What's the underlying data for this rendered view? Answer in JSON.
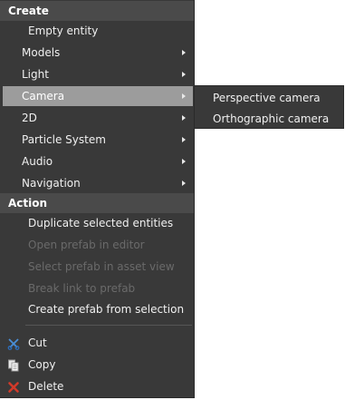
{
  "context_menu": {
    "create_header": "Create",
    "create_items": [
      {
        "label": "Empty entity"
      },
      {
        "label": "Models"
      },
      {
        "label": "Light"
      },
      {
        "label": "Camera"
      },
      {
        "label": "2D"
      },
      {
        "label": "Particle System"
      },
      {
        "label": "Audio"
      },
      {
        "label": "Navigation"
      }
    ],
    "action_header": "Action",
    "action_items": [
      {
        "label": "Duplicate selected entities",
        "enabled": true
      },
      {
        "label": "Open prefab in editor",
        "enabled": false
      },
      {
        "label": "Select prefab in asset view",
        "enabled": false
      },
      {
        "label": "Break link to prefab",
        "enabled": false
      },
      {
        "label": "Create prefab from selection",
        "enabled": true
      }
    ],
    "edit_items": [
      {
        "label": "Cut",
        "icon": "scissors-icon"
      },
      {
        "label": "Copy",
        "icon": "copy-icon"
      },
      {
        "label": "Delete",
        "icon": "delete-icon"
      }
    ]
  },
  "camera_submenu": {
    "items": [
      {
        "label": "Perspective camera"
      },
      {
        "label": "Orthographic camera"
      }
    ]
  }
}
